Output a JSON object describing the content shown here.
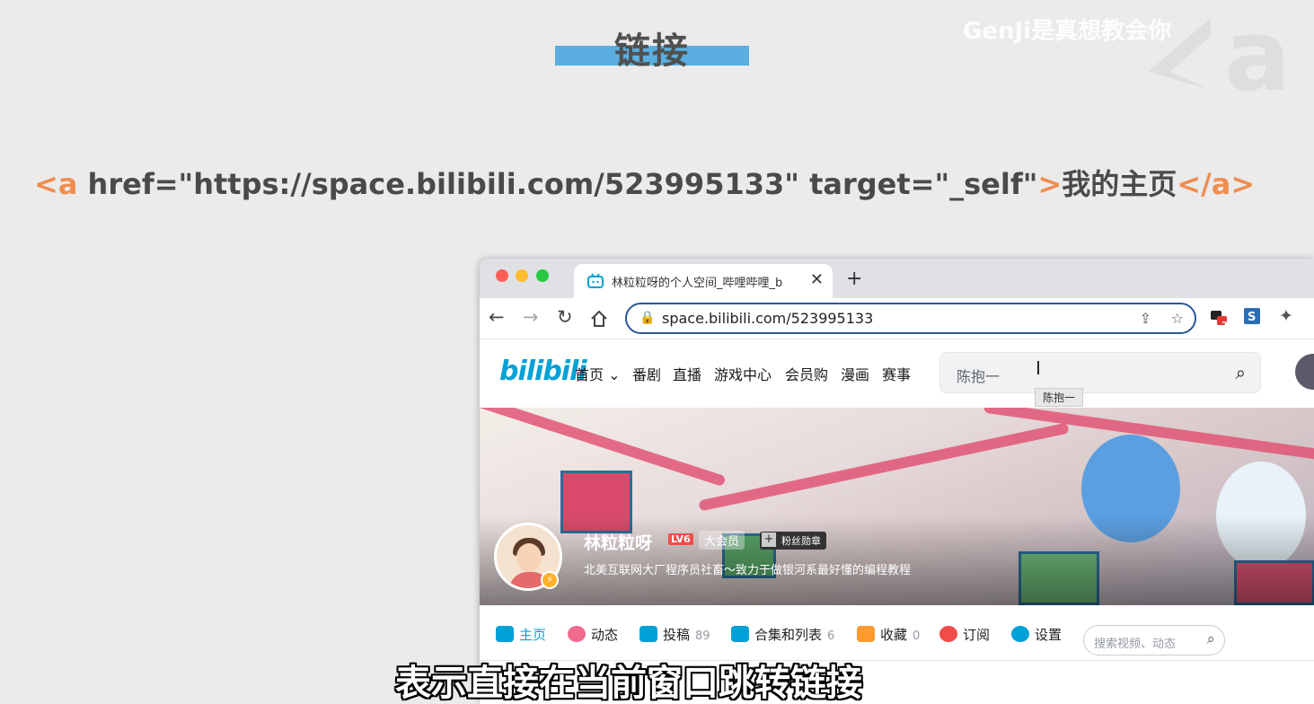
{
  "slide": {
    "title": "链接",
    "watermark": "GenJi是真想教会你",
    "code": {
      "open_tag": "<a",
      "attrs": " href=\"https://space.bilibili.com/523995133\" target=\"_self\"",
      "gt": ">",
      "text": "我的主页",
      "close_tag": "</a>"
    },
    "subtitle": "表示直接在当前窗口跳转链接"
  },
  "browser": {
    "tab_title": "林粒粒呀的个人空间_哔哩哔哩_b",
    "url": "space.bilibili.com/523995133",
    "ext_badge": "2"
  },
  "bili": {
    "logo": "bilibili",
    "nav": [
      "首页",
      "番剧",
      "直播",
      "游戏中心",
      "会员购",
      "漫画",
      "赛事"
    ],
    "search_value": "陈抱一",
    "tooltip": "陈抱一",
    "up": {
      "name": "林粒粒呀",
      "level": "LV6",
      "vip": "大会员",
      "fan_badge": "粉丝勋章",
      "sign": "北美互联网大厂程序员社畜～致力于做银河系最好懂的编程教程"
    },
    "tabs": [
      {
        "label": "主页",
        "count": ""
      },
      {
        "label": "动态",
        "count": ""
      },
      {
        "label": "投稿",
        "count": "89"
      },
      {
        "label": "合集和列表",
        "count": "6"
      },
      {
        "label": "收藏",
        "count": "0"
      },
      {
        "label": "订阅",
        "count": ""
      },
      {
        "label": "设置",
        "count": ""
      }
    ],
    "space_search_placeholder": "搜索视频、动态"
  },
  "colors": {
    "accent_blue": "#5aaee0",
    "code_tag": "#f08e50",
    "bili_blue": "#00a1d6",
    "omnibox_border": "#2b5797"
  }
}
